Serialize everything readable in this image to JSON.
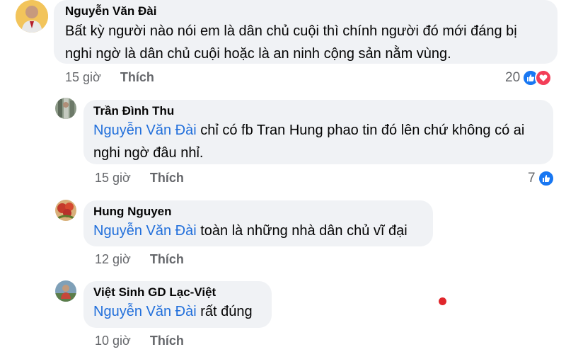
{
  "comments": [
    {
      "author": "Nguyễn Văn Đài",
      "mention": "",
      "text_line1": "Bất kỳ người nào nói em là dân chủ cuội thì chính người đó mới đáng bị",
      "text_line2": "nghi ngờ là dân chủ cuội hoặc là an ninh cộng sản nằm vùng.",
      "time": "15 giờ",
      "like_label": "Thích",
      "reaction_count": "20"
    },
    {
      "author": "Trần Đình Thu",
      "mention": "Nguyễn Văn Đài",
      "text_line1": " chỉ có fb Tran Hung phao tin đó lên chứ không có ai",
      "text_line2": "nghi ngờ đâu nhỉ.",
      "time": "15 giờ",
      "like_label": "Thích",
      "reaction_count": "7"
    },
    {
      "author": "Hung Nguyen",
      "mention": "Nguyễn Văn Đài",
      "text_line1": " toàn là những nhà dân chủ vĩ đại",
      "time": "12 giờ",
      "like_label": "Thích"
    },
    {
      "author": "Việt Sinh GD Lạc-Việt",
      "mention": "Nguyễn Văn Đài",
      "text_line1": " rất đúng",
      "time": "10 giờ",
      "like_label": "Thích"
    }
  ],
  "colors": {
    "bubble": "#f0f2f5",
    "mention": "#216fdb",
    "meta": "#65676b",
    "like_reaction": "#1877f2",
    "love_reaction": "#f33e58"
  },
  "icons": {
    "like_reaction": "thumbs-up-icon",
    "love_reaction": "heart-icon"
  }
}
